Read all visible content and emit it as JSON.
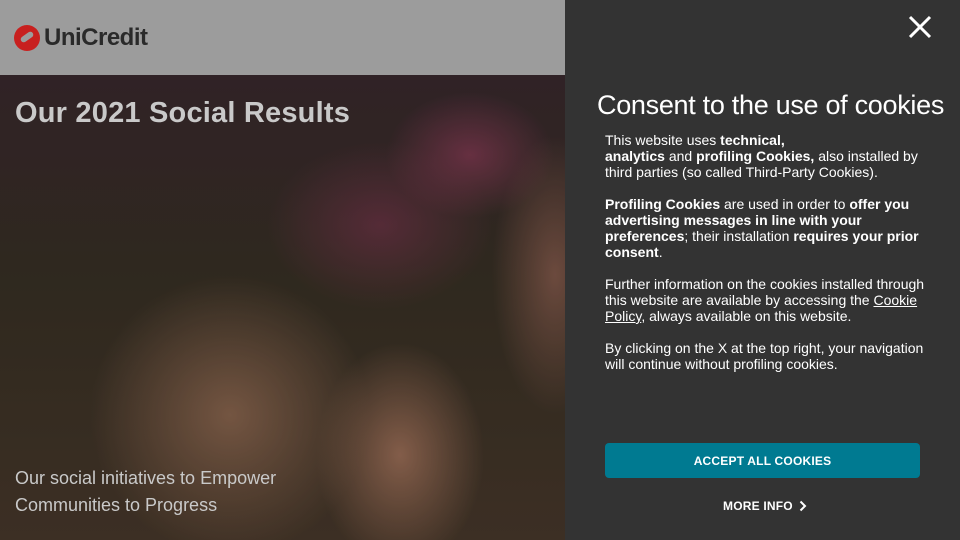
{
  "header": {
    "brand": "UniCredit"
  },
  "hero": {
    "title": "Our 2021 Social Results",
    "subtitle_line1": "Our social initiatives to Empower",
    "subtitle_line2": "Communities to Progress"
  },
  "cookie_panel": {
    "title": "Consent to the use of cookies",
    "close_icon": "close-icon",
    "p1": {
      "a": "This website uses ",
      "b": "technical,",
      "c": "analytics",
      "d": " and ",
      "e": "profiling Cookies,",
      "f": " also installed by third parties (so called Third-Party Cookies)."
    },
    "p2": {
      "a": "Profiling Cookies",
      "b": " are used in order to ",
      "c": "offer you advertising messages in line with your preferences",
      "d": "; their installation ",
      "e": "requires your prior consent",
      "f": "."
    },
    "p3": {
      "a": "Further information on the cookies installed through this website are available by accessing the ",
      "link": "Cookie Policy",
      "b": ", always available on this website."
    },
    "p4": "By clicking on the X at the top right, your navigation will continue without profiling cookies.",
    "accept_label": "ACCEPT ALL COOKIES",
    "more_info_label": "MORE INFO",
    "accent_color": "#007a91"
  }
}
